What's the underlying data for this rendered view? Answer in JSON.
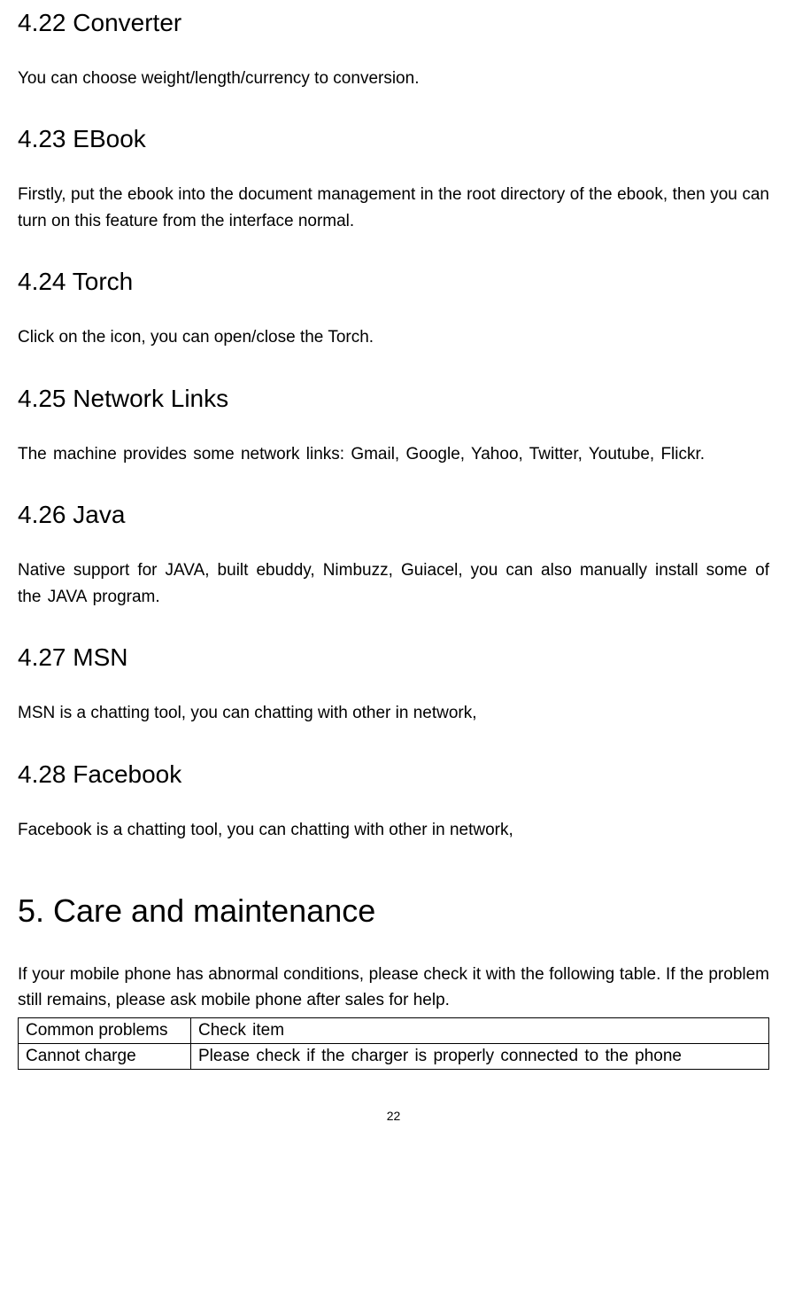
{
  "sections": {
    "s422": {
      "heading": "4.22 Converter",
      "body": "You can choose weight/length/currency to conversion."
    },
    "s423": {
      "heading": "4.23 EBook",
      "body": "Firstly, put the ebook into the document management in the root directory of the ebook, then you can turn on this feature from the interface normal."
    },
    "s424": {
      "heading": "4.24 Torch",
      "body": "Click on the icon, you can open/close the Torch."
    },
    "s425": {
      "heading": "4.25 Network Links",
      "body": "The machine provides some network links: Gmail, Google, Yahoo, Twitter, Youtube, Flickr."
    },
    "s426": {
      "heading": "4.26 Java",
      "body": "Native support for JAVA, built ebuddy, Nimbuzz, Guiacel, you can also manually install some of the JAVA program."
    },
    "s427": {
      "heading": "4.27 MSN",
      "body": "MSN is a chatting tool, you can chatting with other in network,"
    },
    "s428": {
      "heading": "4.28 Facebook",
      "body": "Facebook is a chatting tool, you can chatting with other in network,"
    }
  },
  "chapter5": {
    "heading": "5. Care and maintenance",
    "intro": "If your mobile phone has abnormal conditions, please check it with the following table. If the problem still remains, please ask mobile phone after sales for help.",
    "table": {
      "header": {
        "c1": "Common problems",
        "c2": "Check item"
      },
      "row1": {
        "c1": "Cannot charge",
        "c2": "Please check if the charger is properly connected to the phone"
      }
    }
  },
  "page_number": "22"
}
